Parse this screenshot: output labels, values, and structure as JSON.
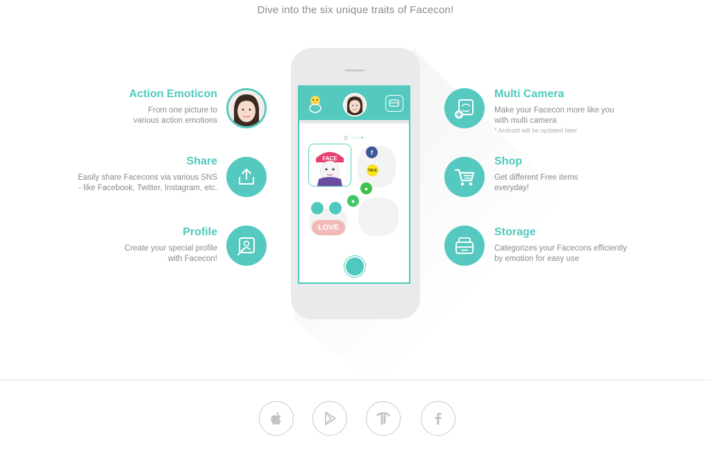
{
  "header": {
    "tagline": "Dive into the six unique traits of Facecon!"
  },
  "features_left": [
    {
      "title": "Action Emoticon",
      "desc1": "From one picture to",
      "desc2": "various action emotions",
      "icon": "face-avatar-icon"
    },
    {
      "title": "Share",
      "desc1": "Easily share Facecons via various SNS",
      "desc2": "- like Facebook, Twitter, Instagram, etc.",
      "icon": "share-upload-icon"
    },
    {
      "title": "Profile",
      "desc1": "Create your special profile",
      "desc2": "with Facecon!",
      "icon": "profile-edit-icon"
    }
  ],
  "features_right": [
    {
      "title": "Multi Camera",
      "desc1": "Make your Facecon more like you",
      "desc2": "with multi camera",
      "note": "* Android will be updated later",
      "icon": "multi-camera-icon"
    },
    {
      "title": "Shop",
      "desc1": "Get different Free items",
      "desc2": "everyday!",
      "icon": "shopping-cart-icon"
    },
    {
      "title": "Storage",
      "desc1": "Categorizes your Facecons efficiently",
      "desc2": "by emotion for easy use",
      "icon": "storage-drawer-icon"
    }
  ],
  "phone": {
    "sticker_text": "FACE",
    "love_text": "LOVE",
    "talk_text": "TALK",
    "fb_text": "f"
  },
  "stores": [
    {
      "name": "App Store",
      "icon": "apple-icon"
    },
    {
      "name": "Google Play",
      "icon": "google-play-icon"
    },
    {
      "name": "T store",
      "icon": "tstore-icon"
    },
    {
      "name": "Facebook",
      "icon": "facebook-icon"
    }
  ],
  "colors": {
    "accent": "#55c9bf",
    "text": "#8a8a8a",
    "phone": "#e9eaec"
  }
}
